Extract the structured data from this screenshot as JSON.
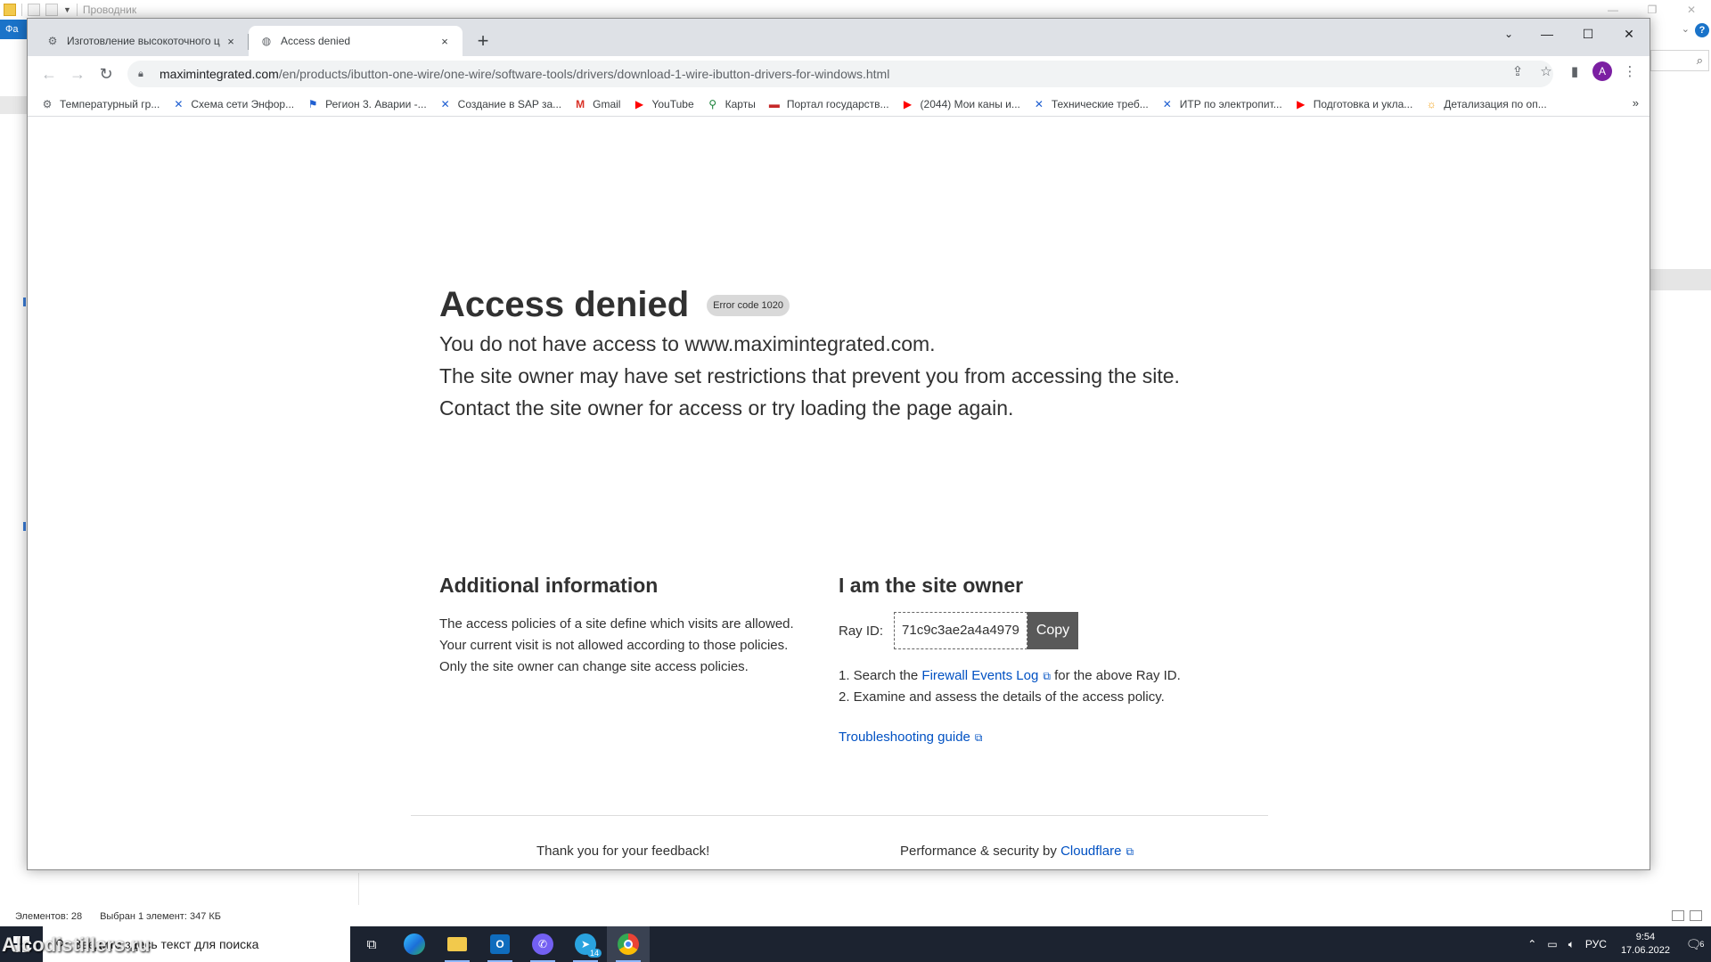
{
  "explorer": {
    "title": "Проводник",
    "file_tab": "Фа",
    "help": "?",
    "status": {
      "items": "Элементов: 28",
      "selected": "Выбран 1 элемент: 347 КБ"
    }
  },
  "browser": {
    "tabs": [
      {
        "title": "Изготовление высокоточного ц",
        "close": "×"
      },
      {
        "title": "Access denied",
        "close": "×"
      }
    ],
    "new_tab": "+",
    "address": {
      "host": "maximintegrated.com",
      "path": "/en/products/ibutton-one-wire/one-wire/software-tools/drivers/download-1-wire-ibutton-drivers-for-windows.html"
    },
    "profile_initial": "A",
    "bookmarks": [
      {
        "label": "Температурный гр...",
        "icon": "gen"
      },
      {
        "label": "Схема сети Энфор...",
        "icon": "jira"
      },
      {
        "label": "Регион 3. Аварии -...",
        "icon": "jira"
      },
      {
        "label": "Создание в SAP за...",
        "icon": "jira"
      },
      {
        "label": "Gmail",
        "icon": "gmail"
      },
      {
        "label": "YouTube",
        "icon": "yt"
      },
      {
        "label": "Карты",
        "icon": "maps"
      },
      {
        "label": "Портал государств...",
        "icon": "gov"
      },
      {
        "label": "(2044) Мои каны и...",
        "icon": "yt"
      },
      {
        "label": "Технические треб...",
        "icon": "jira"
      },
      {
        "label": "ИТР по электропит...",
        "icon": "jira"
      },
      {
        "label": "Подготовка и укла...",
        "icon": "yt"
      },
      {
        "label": "Детализация по оп...",
        "icon": "orange"
      }
    ],
    "bookmarks_more": "»"
  },
  "page": {
    "title": "Access denied",
    "error_code": "Error code 1020",
    "lines": [
      "You do not have access to www.maximintegrated.com.",
      "The site owner may have set restrictions that prevent you from accessing the site.",
      "Contact the site owner for access or try loading the page again."
    ],
    "additional": {
      "heading": "Additional information",
      "lines": [
        "The access policies of a site define which visits are allowed.",
        "Your current visit is not allowed according to those policies.",
        "Only the site owner can change site access policies."
      ]
    },
    "owner": {
      "heading": "I am the site owner",
      "ray_label": "Ray ID:",
      "ray_id": "71c9c3ae2a4a4979",
      "copy": "Copy",
      "step1_pre": "1. Search the",
      "step1_link": "Firewall Events Log",
      "step1_post": "for the above Ray ID.",
      "step2": "2. Examine and assess the details of the access policy.",
      "troubleshooting": "Troubleshooting guide"
    },
    "footer": {
      "feedback": "Thank you for your feedback!",
      "perf_pre": "Performance & security by",
      "perf_link": "Cloudflare"
    }
  },
  "taskbar": {
    "search_placeholder": "Введите здесь текст для поиска",
    "telegram_badge": "14",
    "language": "РУС",
    "time": "9:54",
    "date": "17.06.2022",
    "notifications": "6",
    "watermark": "Alcodistillers.ru"
  }
}
